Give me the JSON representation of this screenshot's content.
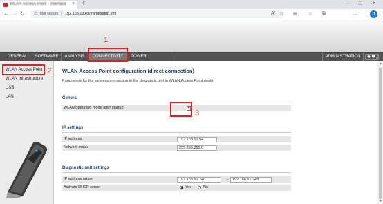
{
  "browser": {
    "tab_title": "WLAN Access Point - Interface",
    "tab_close": "×",
    "new_tab": "+",
    "window_controls": [
      "–",
      "□",
      "×"
    ],
    "back": "←",
    "forward": "→",
    "reload": "↻",
    "security_icon": "⚠",
    "security_text": "Not secure",
    "url": "192.168.13.69/framesetup.xml",
    "toolbar_icons": [
      "A'",
      "☆",
      "⊞",
      "☆",
      "⧉",
      "…"
    ],
    "bing_label": "b"
  },
  "menu": {
    "items": [
      "GENERAL",
      "SOFTWARE",
      "ANALYSIS",
      "CONNECTIVITY",
      "POWER MANAGEMENT",
      "ADMINISTRATION"
    ],
    "active": "CONNECTIVITY",
    "globe_icon": "🌐"
  },
  "sidebar": {
    "items": [
      "WLAN Access Point",
      "WLAN Infrastructure",
      "USB",
      "LAN"
    ],
    "selected": "WLAN Access Point"
  },
  "content": {
    "title": "WLAN Access Point configuration (direct connection)",
    "description": "Parameters for the wireless connection to the diagnostic unit in WLAN Access Point mode",
    "general": {
      "heading": "General",
      "wlan_startup_label": "WLAN operating mode after startup",
      "wlan_startup_checked": true,
      "check_mark": "✔"
    },
    "ip_settings": {
      "heading": "IP settings",
      "ip_address_label": "IP address",
      "ip_address_value": "192.168.61.54",
      "netmask_label": "Network mask",
      "netmask_value": "255.255.255.0"
    },
    "diagnostic": {
      "heading": "Diagnostic unit settings",
      "ip_range_label": "IP address range",
      "ip_range_from": "192.168.61.240",
      "ip_range_sep": "...",
      "ip_range_to": "192.168.61.248",
      "dhcp_label": "Activate DHCP server",
      "dhcp_yes": "Yes",
      "dhcp_no": "No",
      "dhcp_value": "Yes"
    }
  },
  "annotations": {
    "one": "1",
    "two": "2",
    "three": "3",
    "color": "#e02020"
  }
}
